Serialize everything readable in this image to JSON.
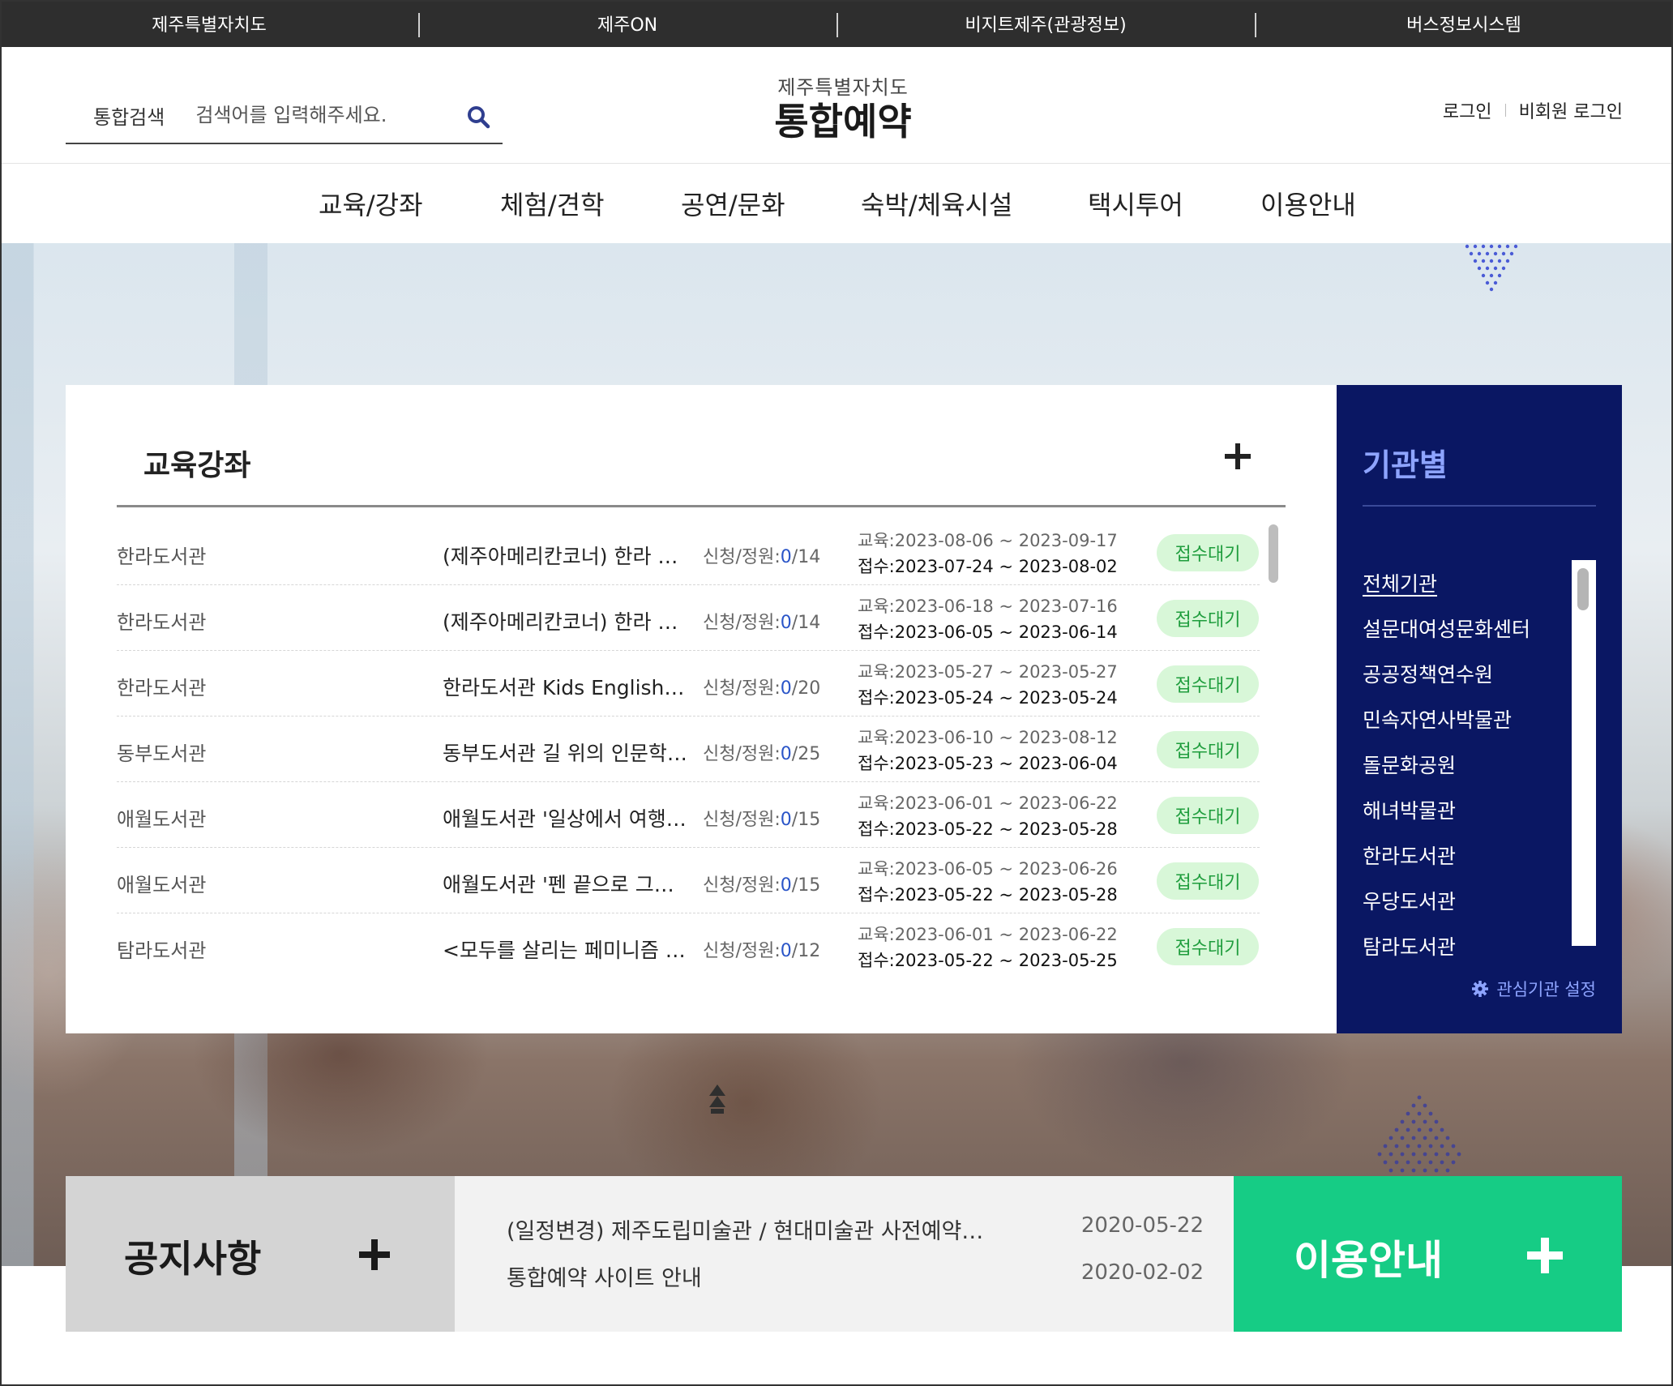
{
  "topbar": {
    "links": [
      "제주특별자치도",
      "제주ON",
      "비지트제주(관광정보)",
      "버스정보시스템"
    ]
  },
  "header": {
    "search_label": "통합검색",
    "search_placeholder": "검색어를 입력해주세요.",
    "logo_sub": "제주특별자치도",
    "logo_main": "통합예약",
    "login": "로그인",
    "guest_login": "비회원 로그인"
  },
  "nav": {
    "items": [
      "교육/강좌",
      "체험/견학",
      "공연/문화",
      "숙박/체육시설",
      "택시투어",
      "이용안내"
    ]
  },
  "edu": {
    "title": "교육강좌",
    "cap_label": "신청/정원:",
    "edu_label": "교육:",
    "rcv_label": "접수:",
    "rows": [
      {
        "org": "한라도서관",
        "title": "(제주아메리칸코너) 한라 R…",
        "cap": "0",
        "total": "/14",
        "edu": "2023-08-06 ~ 2023-09-17",
        "rcv": "2023-07-24 ~ 2023-08-02",
        "status": "접수대기"
      },
      {
        "org": "한라도서관",
        "title": "(제주아메리칸코너) 한라 R…",
        "cap": "0",
        "total": "/14",
        "edu": "2023-06-18 ~ 2023-07-16",
        "rcv": "2023-06-05 ~ 2023-06-14",
        "status": "접수대기"
      },
      {
        "org": "한라도서관",
        "title": "한라도서관 Kids English T…",
        "cap": "0",
        "total": "/20",
        "edu": "2023-05-27 ~ 2023-05-27",
        "rcv": "2023-05-24 ~ 2023-05-24",
        "status": "접수대기"
      },
      {
        "org": "동부도서관",
        "title": "동부도서관 길 위의 인문학…",
        "cap": "0",
        "total": "/25",
        "edu": "2023-06-10 ~ 2023-08-12",
        "rcv": "2023-05-23 ~ 2023-06-04",
        "status": "접수대기"
      },
      {
        "org": "애월도서관",
        "title": "애월도서관 '일상에서 여행…",
        "cap": "0",
        "total": "/15",
        "edu": "2023-06-01 ~ 2023-06-22",
        "rcv": "2023-05-22 ~ 2023-05-28",
        "status": "접수대기"
      },
      {
        "org": "애월도서관",
        "title": "애월도서관 '펜 끝으로 그리…",
        "cap": "0",
        "total": "/15",
        "edu": "2023-06-05 ~ 2023-06-26",
        "rcv": "2023-05-22 ~ 2023-05-28",
        "status": "접수대기"
      },
      {
        "org": "탐라도서관",
        "title": "<모두를 살리는 페미니즘 …",
        "cap": "0",
        "total": "/12",
        "edu": "2023-06-01 ~ 2023-06-22",
        "rcv": "2023-05-22 ~ 2023-05-25",
        "status": "접수대기"
      }
    ]
  },
  "side": {
    "title": "기관별",
    "items": [
      "전체기관",
      "설문대여성문화센터",
      "공공정책연수원",
      "민속자연사박물관",
      "돌문화공원",
      "해녀박물관",
      "한라도서관",
      "우당도서관",
      "탐라도서관"
    ],
    "setting": "관심기관 설정"
  },
  "notice": {
    "title": "공지사항",
    "items": [
      {
        "title": "(일정변경) 제주도립미술관 / 현대미술관 사전예약…",
        "date": "2020-05-22"
      },
      {
        "title": "통합예약 사이트 안내",
        "date": "2020-02-02"
      }
    ]
  },
  "guide": {
    "title": "이용안내"
  },
  "colors": {
    "topbar": "#2e2e2e",
    "side_panel": "#0a1763",
    "side_accent": "#8ea4ff",
    "guide": "#16cc85",
    "badge_bg": "#d8f7d8",
    "badge_text": "#1f9d3d",
    "count_blue": "#2a55c8"
  }
}
